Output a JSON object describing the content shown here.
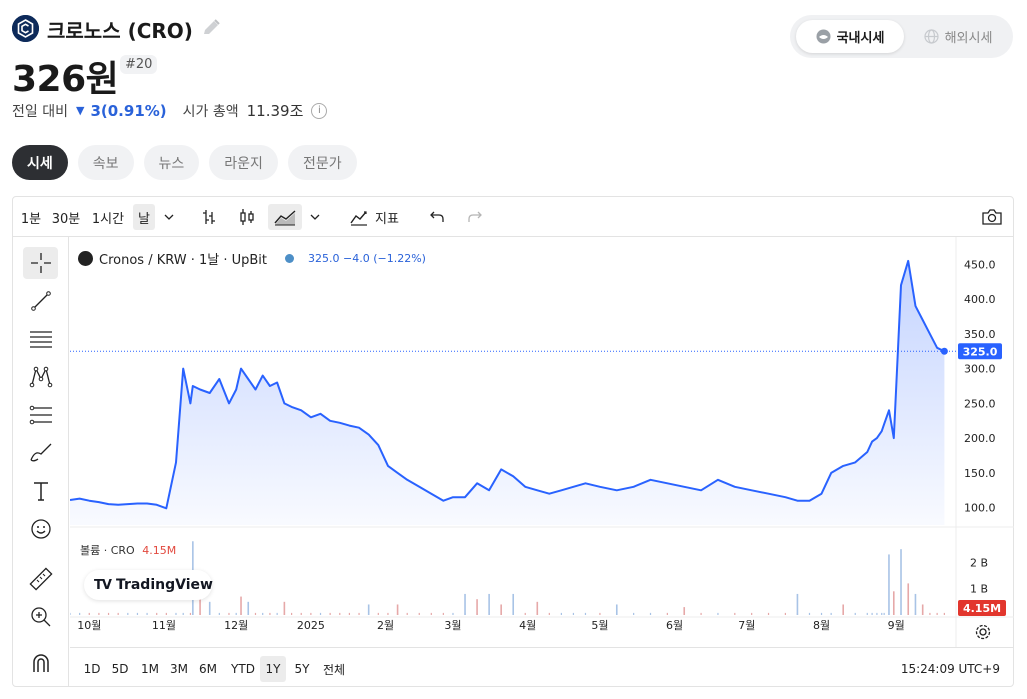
{
  "header": {
    "coin_name": "크로노스 (CRO)",
    "price": "326원",
    "rank": "#20",
    "change_label": "전일 대비",
    "change_value": "3(0.91%)",
    "market_cap_label": "시가 총액",
    "market_cap_value": "11.39조"
  },
  "market_toggle": {
    "options": [
      "국내시세",
      "해외시세"
    ],
    "selected": "국내시세"
  },
  "tabs": [
    {
      "label": "시세",
      "active": true
    },
    {
      "label": "속보",
      "active": false
    },
    {
      "label": "뉴스",
      "active": false
    },
    {
      "label": "라운지",
      "active": false
    },
    {
      "label": "전문가",
      "active": false
    }
  ],
  "toolbar": {
    "intervals": [
      "1분",
      "30분",
      "1시간",
      "날"
    ],
    "selected_interval": "날",
    "indicators_label": "지표"
  },
  "legend": {
    "symbol": "Cronos / KRW · 1날 · UpBit",
    "ohlc": "325.0 −4.0 (−1.22%)"
  },
  "volume_legend": {
    "label": "볼륨 · CRO",
    "value": "4.15M"
  },
  "branding": {
    "label": "TradingView"
  },
  "ranges": [
    "1D",
    "5D",
    "1M",
    "3M",
    "6M",
    "YTD",
    "1Y",
    "5Y",
    "전체"
  ],
  "selected_range": "1Y",
  "clock": "15:24:09 UTC+9",
  "colors": {
    "line": "#2962ff",
    "down_text": "#2a62d9",
    "volume_up": "#a8c3e6",
    "volume_down": "#e6a8a8",
    "last_price_label": "#2962ff",
    "volume_label": "#e2362d"
  },
  "chart_data": {
    "type": "area",
    "x_tick_labels": [
      "10월",
      "11월",
      "12월",
      "2025",
      "2월",
      "3월",
      "4월",
      "5월",
      "6월",
      "7월",
      "8월",
      "9월"
    ],
    "y_tick_labels": [
      "100.0",
      "150.0",
      "200.0",
      "250.0",
      "300.0",
      "350.0",
      "400.0",
      "450.0"
    ],
    "ylim": [
      75,
      475
    ],
    "last_price": 325.0,
    "last_price_label": "325.0",
    "x": [
      "2024-09-23",
      "2024-09-27",
      "2024-10-01",
      "2024-10-05",
      "2024-10-09",
      "2024-10-13",
      "2024-10-17",
      "2024-10-21",
      "2024-10-25",
      "2024-10-29",
      "2024-11-02",
      "2024-11-06",
      "2024-11-09",
      "2024-11-12",
      "2024-11-13",
      "2024-11-16",
      "2024-11-20",
      "2024-11-24",
      "2024-11-28",
      "2024-12-01",
      "2024-12-03",
      "2024-12-06",
      "2024-12-09",
      "2024-12-12",
      "2024-12-15",
      "2024-12-18",
      "2024-12-21",
      "2024-12-24",
      "2024-12-28",
      "2025-01-01",
      "2025-01-05",
      "2025-01-09",
      "2025-01-13",
      "2025-01-17",
      "2025-01-21",
      "2025-01-25",
      "2025-01-29",
      "2025-02-02",
      "2025-02-06",
      "2025-02-10",
      "2025-02-15",
      "2025-02-20",
      "2025-02-25",
      "2025-03-01",
      "2025-03-06",
      "2025-03-11",
      "2025-03-16",
      "2025-03-21",
      "2025-03-26",
      "2025-03-31",
      "2025-04-05",
      "2025-04-10",
      "2025-04-15",
      "2025-04-20",
      "2025-04-25",
      "2025-05-01",
      "2025-05-08",
      "2025-05-15",
      "2025-05-22",
      "2025-05-29",
      "2025-06-05",
      "2025-06-12",
      "2025-06-19",
      "2025-06-26",
      "2025-07-03",
      "2025-07-10",
      "2025-07-17",
      "2025-07-22",
      "2025-07-27",
      "2025-08-01",
      "2025-08-05",
      "2025-08-10",
      "2025-08-15",
      "2025-08-20",
      "2025-08-22",
      "2025-08-24",
      "2025-08-26",
      "2025-08-27",
      "2025-08-29",
      "2025-08-31",
      "2025-09-03",
      "2025-09-06",
      "2025-09-09",
      "2025-09-12",
      "2025-09-15",
      "2025-09-18",
      "2025-09-21"
    ],
    "series": [
      {
        "values": [
          111,
          113,
          110,
          108,
          105,
          104,
          105,
          106,
          106,
          104,
          99,
          165,
          300,
          250,
          275,
          270,
          265,
          285,
          250,
          270,
          300,
          285,
          270,
          290,
          275,
          280,
          250,
          245,
          240,
          230,
          235,
          225,
          222,
          218,
          215,
          205,
          190,
          160,
          150,
          140,
          130,
          120,
          110,
          115,
          115,
          135,
          125,
          155,
          145,
          130,
          125,
          120,
          125,
          130,
          135,
          130,
          125,
          130,
          140,
          135,
          130,
          125,
          140,
          130,
          125,
          120,
          115,
          110,
          110,
          120,
          150,
          160,
          165,
          180,
          195,
          200,
          210,
          220,
          240,
          200,
          420,
          455,
          390,
          370,
          350,
          330,
          325
        ]
      }
    ],
    "volume": {
      "label": "볼륨 · CRO",
      "axis_labels": [
        "2 B",
        "1 B"
      ],
      "last_value_label": "4.15M",
      "x": [
        "2024-11-13",
        "2024-11-16",
        "2024-11-20",
        "2024-12-03",
        "2024-12-06",
        "2024-12-21",
        "2025-01-25",
        "2025-02-06",
        "2025-03-06",
        "2025-03-11",
        "2025-03-16",
        "2025-03-21",
        "2025-03-26",
        "2025-04-05",
        "2025-05-08",
        "2025-06-05",
        "2025-07-22",
        "2025-08-10",
        "2025-08-29",
        "2025-08-31",
        "2025-09-03",
        "2025-09-06",
        "2025-09-09",
        "2025-09-12"
      ],
      "values": [
        2.8,
        0.9,
        0.5,
        0.7,
        0.5,
        0.5,
        0.4,
        0.4,
        0.8,
        0.6,
        0.8,
        0.4,
        0.8,
        0.5,
        0.4,
        0.3,
        0.8,
        0.4,
        2.3,
        0.9,
        2.5,
        1.2,
        0.8,
        0.4
      ]
    }
  }
}
